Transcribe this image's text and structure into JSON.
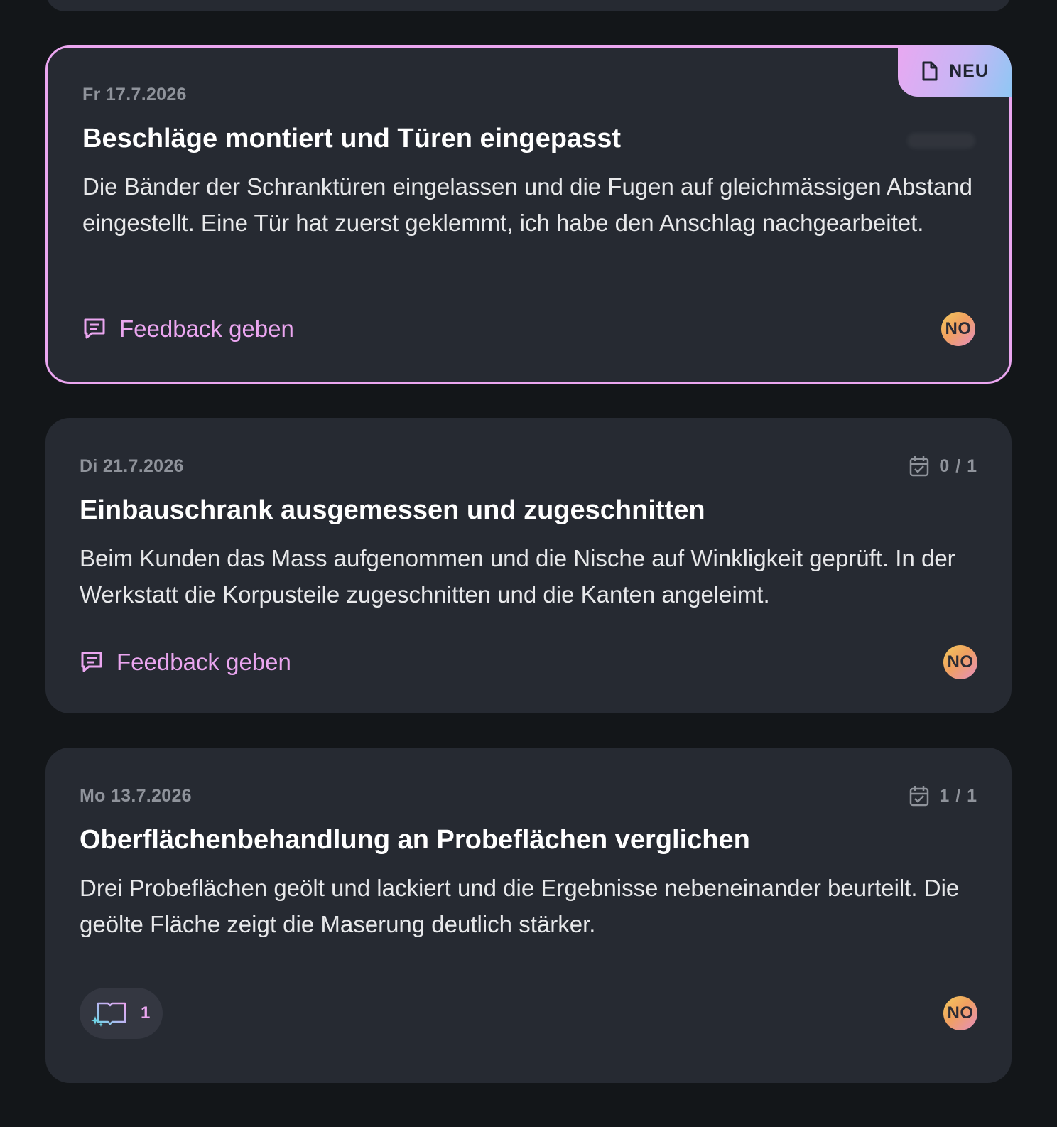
{
  "colors": {
    "background": "#131619",
    "card": "#262a32",
    "accent_pink": "#eba6f0",
    "muted_text": "#8f939b",
    "body_text": "#e7e8ea"
  },
  "cards": [
    {
      "date": "Fr 17.7.2026",
      "badge": "NEU",
      "badge_icon": "document-icon",
      "title": "Beschläge montiert und Türen eingepasst",
      "body": "Die Bänder der Schranktüren eingelassen und die Fugen auf gleichmässigen Abstand eingestellt. Eine Tür hat zuerst geklemmt, ich habe den Anschlag nachgearbeitet.",
      "feedback_label": "Feedback geben",
      "avatar": "NO",
      "highlighted": true
    },
    {
      "date": "Di 21.7.2026",
      "progress": "0 / 1",
      "progress_icon": "calendar-check-icon",
      "title": "Einbauschrank ausgemessen und zugeschnitten",
      "body": "Beim Kunden das Mass aufgenommen und die Nische auf Winkligkeit geprüft. In der Werkstatt die Korpusteile zugeschnitten und die Kanten angeleimt.",
      "feedback_label": "Feedback geben",
      "avatar": "NO"
    },
    {
      "date": "Mo 13.7.2026",
      "progress": "1 / 1",
      "progress_icon": "calendar-check-icon",
      "title": "Oberflächenbehandlung an Probeflächen verglichen",
      "body": "Drei Probeflächen geölt und lackiert und die Ergebnisse nebeneinander beurteilt. Die geölte Fläche zeigt die Maserung deutlich stärker.",
      "learning_count": "1",
      "learning_icon": "book-sparkle-icon",
      "avatar": "NO"
    }
  ]
}
